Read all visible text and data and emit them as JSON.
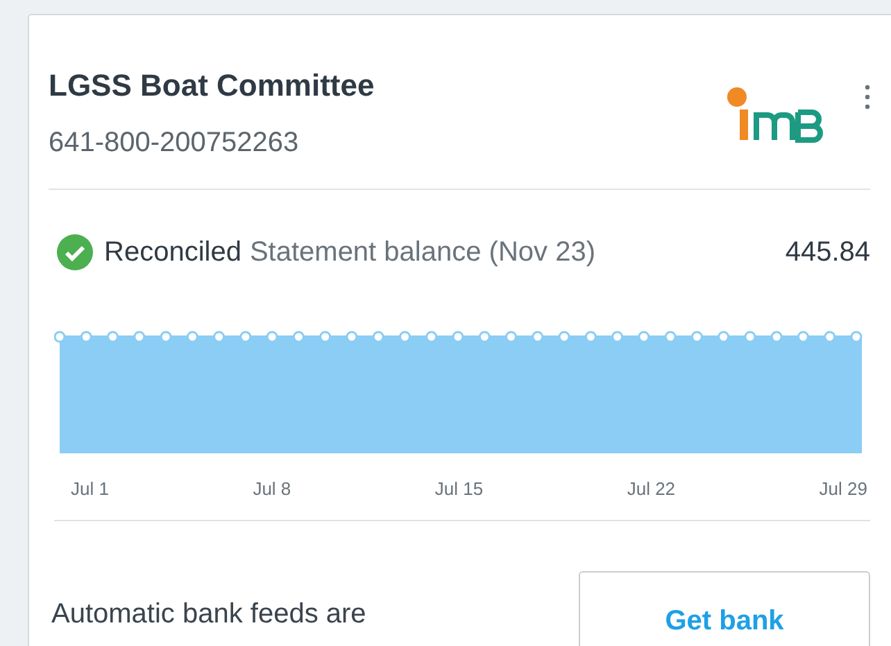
{
  "account": {
    "name": "LGSS Boat Committee",
    "number": "641-800-200752263"
  },
  "status": {
    "reconciled": true,
    "label": "Reconciled",
    "description": "Statement balance (Nov 23)",
    "balance": "445.84"
  },
  "chart": {
    "x_labels": [
      "Jul 1",
      "Jul 8",
      "Jul 15",
      "Jul 22",
      "Jul 29"
    ]
  },
  "bank_feeds": {
    "message": "Automatic bank feeds are",
    "button": "Get bank"
  }
}
